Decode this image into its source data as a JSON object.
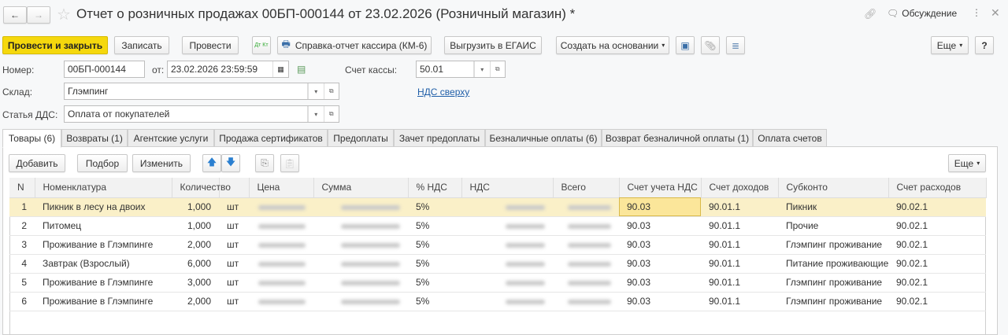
{
  "title": "Отчет о розничных продажах 00БП-000144 от 23.02.2026 (Розничный магазин) *",
  "header": {
    "discussion": "Обсуждение"
  },
  "toolbar": {
    "post_close": "Провести и закрыть",
    "save": "Записать",
    "post": "Провести",
    "cashier_report": "Справка-отчет кассира (КМ-6)",
    "egais": "Выгрузить в ЕГАИС",
    "create_based": "Создать на основании",
    "more": "Еще",
    "help": "?",
    "dtkt": "Дт Кт"
  },
  "form": {
    "number_label": "Номер:",
    "number": "00БП-000144",
    "date_label": "от:",
    "date": "23.02.2026 23:59:59",
    "cash_account_label": "Счет кассы:",
    "cash_account": "50.01",
    "warehouse_label": "Склад:",
    "warehouse": "Глэмпинг",
    "dds_label": "Статья ДДС:",
    "dds": "Оплата от покупателей",
    "vat_link": "НДС сверху"
  },
  "tabs": [
    "Товары (6)",
    "Возвраты (1)",
    "Агентские услуги",
    "Продажа сертификатов",
    "Предоплаты",
    "Зачет предоплаты",
    "Безналичные оплаты (6)",
    "Возврат безналичной оплаты (1)",
    "Оплата счетов"
  ],
  "table_toolbar": {
    "add": "Добавить",
    "pick": "Подбор",
    "edit": "Изменить",
    "more": "Еще"
  },
  "columns": [
    "N",
    "Номенклатура",
    "Количество",
    "",
    "Цена",
    "Сумма",
    "% НДС",
    "НДС",
    "Всего",
    "Счет учета НДС",
    "Счет доходов",
    "Субконто",
    "Счет расходов"
  ],
  "rows": [
    {
      "n": "1",
      "item": "Пикник в лесу на двоих",
      "qty": "1,000",
      "unit": "шт",
      "vat_rate": "5%",
      "vat_acc": "90.03",
      "income_acc": "90.01.1",
      "subconto": "Пикник",
      "expense_acc": "90.02.1"
    },
    {
      "n": "2",
      "item": "Питомец",
      "qty": "1,000",
      "unit": "шт",
      "vat_rate": "5%",
      "vat_acc": "90.03",
      "income_acc": "90.01.1",
      "subconto": "Прочие",
      "expense_acc": "90.02.1"
    },
    {
      "n": "3",
      "item": "Проживание в Глэмпинге",
      "qty": "2,000",
      "unit": "шт",
      "vat_rate": "5%",
      "vat_acc": "90.03",
      "income_acc": "90.01.1",
      "subconto": "Глэмпинг проживание",
      "expense_acc": "90.02.1"
    },
    {
      "n": "4",
      "item": "Завтрак (Взрослый)",
      "qty": "6,000",
      "unit": "шт",
      "vat_rate": "5%",
      "vat_acc": "90.03",
      "income_acc": "90.01.1",
      "subconto": "Питание проживающие",
      "expense_acc": "90.02.1"
    },
    {
      "n": "5",
      "item": "Проживание в Глэмпинге",
      "qty": "3,000",
      "unit": "шт",
      "vat_rate": "5%",
      "vat_acc": "90.03",
      "income_acc": "90.01.1",
      "subconto": "Глэмпинг проживание",
      "expense_acc": "90.02.1"
    },
    {
      "n": "6",
      "item": "Проживание в Глэмпинге",
      "qty": "2,000",
      "unit": "шт",
      "vat_rate": "5%",
      "vat_acc": "90.03",
      "income_acc": "90.01.1",
      "subconto": "Глэмпинг проживание",
      "expense_acc": "90.02.1"
    }
  ],
  "colors": {
    "primary": "#f5d80d",
    "selected_row": "#faf0c8",
    "link": "#1f5ea8"
  }
}
